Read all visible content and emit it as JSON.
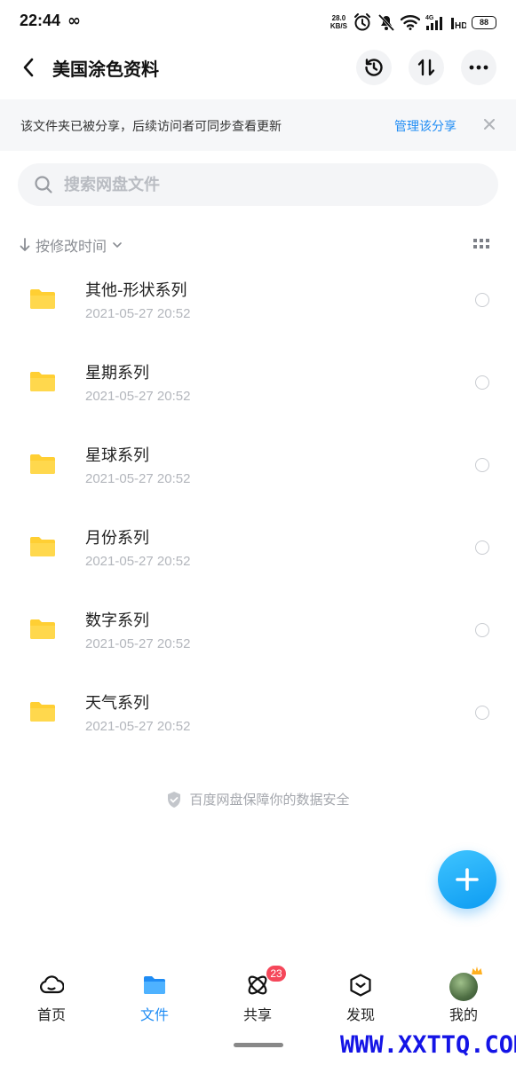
{
  "status_bar": {
    "time": "22:44",
    "infinity": "∞",
    "net_speed_value": "28.0",
    "net_speed_unit": "KB/S",
    "battery": "88"
  },
  "header": {
    "title": "美国涂色资料",
    "icons": [
      "back-arrow-icon",
      "history-clock-icon",
      "transfer-icon",
      "more-icon"
    ]
  },
  "banner": {
    "text": "该文件夹已被分享，后续访问者可同步查看更新",
    "link": "管理该分享",
    "close": "×"
  },
  "search": {
    "placeholder": "搜索网盘文件",
    "value": ""
  },
  "sort": {
    "label": "按修改时间"
  },
  "files": [
    {
      "name": "其他-形状系列",
      "date": "2021-05-27  20:52"
    },
    {
      "name": "星期系列",
      "date": "2021-05-27  20:52"
    },
    {
      "name": "星球系列",
      "date": "2021-05-27  20:52"
    },
    {
      "name": "月份系列",
      "date": "2021-05-27  20:52"
    },
    {
      "name": "数字系列",
      "date": "2021-05-27  20:52"
    },
    {
      "name": "天气系列",
      "date": "2021-05-27  20:52"
    }
  ],
  "safe_note": "百度网盘保障你的数据安全",
  "bottom_nav": [
    {
      "label": "首页",
      "icon": "cloud-icon"
    },
    {
      "label": "文件",
      "icon": "folder-icon",
      "active": true
    },
    {
      "label": "共享",
      "icon": "share-orbit-icon",
      "badge": "23"
    },
    {
      "label": "发现",
      "icon": "discover-box-icon"
    },
    {
      "label": "我的",
      "icon": "avatar"
    }
  ],
  "watermark": "WWW.XXTTQ.COM",
  "colors": {
    "accent": "#1f8cf4",
    "folder": "#ffcf33",
    "badge": "#f5475a",
    "fab": "#1aaaf7"
  }
}
